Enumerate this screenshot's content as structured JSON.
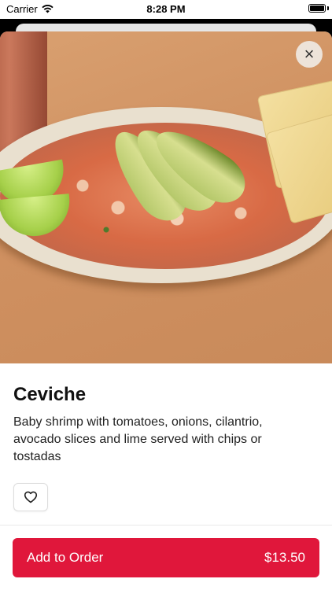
{
  "status_bar": {
    "carrier": "Carrier",
    "time": "8:28 PM"
  },
  "item": {
    "name": "Ceviche",
    "description": "Baby shrimp with tomatoes, onions, cilantrio, avocado slices and lime served with chips or tostadas",
    "price": "$13.50"
  },
  "actions": {
    "close_label": "×",
    "add_to_order_label": "Add to Order"
  },
  "icons": {
    "close": "close-icon",
    "favorite": "heart-outline-icon",
    "wifi": "wifi-icon",
    "battery": "battery-icon"
  },
  "colors": {
    "accent": "#e0173b"
  }
}
